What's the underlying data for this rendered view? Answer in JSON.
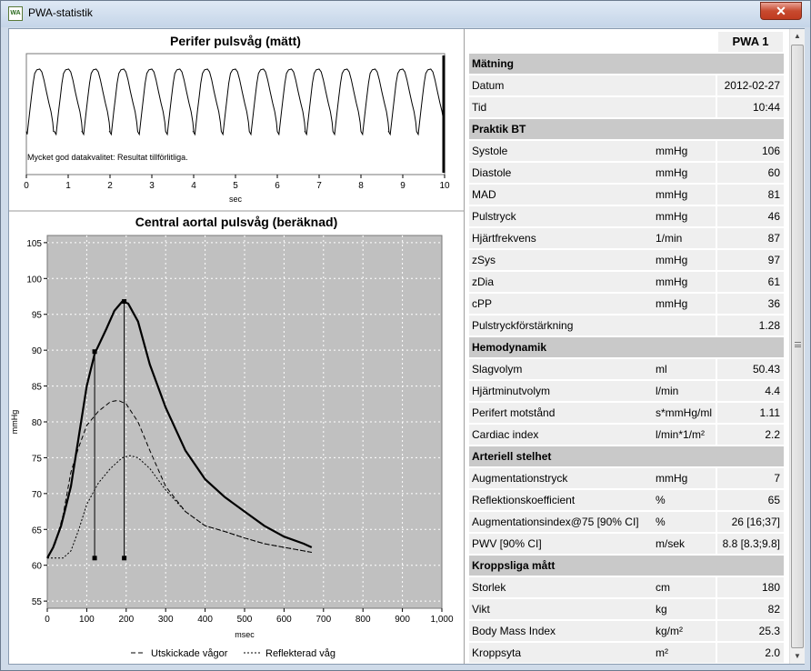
{
  "window": {
    "title": "PWA-statistik",
    "icon": "WA",
    "close_label": "✕"
  },
  "colors": {
    "table_section_bg": "#c9c9c9",
    "table_data_bg": "#efefef",
    "plot_bg": "#c0c0c0"
  },
  "chart_data": [
    {
      "type": "line",
      "title": "Perifer pulsvåg (mätt)",
      "xlabel": "sec",
      "ylabel": "",
      "xlim": [
        0,
        10
      ],
      "x_ticks": [
        "0",
        "1",
        "2",
        "3",
        "4",
        "5",
        "6",
        "7",
        "8",
        "9",
        "10"
      ],
      "annotation": "Mycket god datakvalitet: Resultat tillförlitliga.",
      "series": [
        {
          "beat_times": [
            0.32,
            1.01,
            1.67,
            2.33,
            3.0,
            3.67,
            4.33,
            5.0,
            5.67,
            6.34,
            7.0,
            7.67,
            8.34,
            9.0,
            9.67
          ]
        }
      ]
    },
    {
      "type": "line",
      "title": "Central aortal pulsvåg (beräknad)",
      "xlabel": "msec",
      "ylabel": "mmHg",
      "xlim": [
        0,
        1000
      ],
      "ylim": [
        54,
        106
      ],
      "grid": true,
      "x_ticks": [
        "0",
        "100",
        "200",
        "300",
        "400",
        "500",
        "600",
        "700",
        "800",
        "900",
        "1,000"
      ],
      "y_ticks": [
        "55",
        "60",
        "65",
        "70",
        "75",
        "80",
        "85",
        "90",
        "95",
        "100",
        "105"
      ],
      "legend_position": "bottom",
      "legend": [
        "Utskickade vågor",
        "Reflekterad våg"
      ],
      "series": [
        {
          "style": "solid",
          "x": [
            0,
            15,
            35,
            60,
            80,
            100,
            120,
            150,
            170,
            190,
            205,
            230,
            260,
            300,
            350,
            400,
            450,
            500,
            550,
            600,
            650,
            670
          ],
          "y": [
            61,
            62.5,
            65.5,
            71,
            78,
            85,
            89.5,
            93,
            95.5,
            96.8,
            96.5,
            94,
            88,
            82,
            76,
            72,
            69.5,
            67.5,
            65.5,
            64,
            63,
            62.5
          ]
        },
        {
          "name": "Utskickade vågor",
          "style": "dashed",
          "x": [
            0,
            20,
            40,
            60,
            80,
            100,
            130,
            160,
            180,
            200,
            230,
            260,
            300,
            350,
            400,
            450,
            500,
            550,
            600,
            650,
            670
          ],
          "y": [
            61,
            63,
            67,
            73,
            76.5,
            79.5,
            81.5,
            82.8,
            83,
            82.5,
            80,
            76,
            71,
            67.5,
            65.5,
            64.7,
            63.8,
            63,
            62.5,
            62,
            61.8
          ]
        },
        {
          "name": "Reflekterad våg",
          "style": "dotted",
          "x": [
            0,
            40,
            60,
            80,
            100,
            130,
            160,
            190,
            210,
            230,
            260,
            300,
            350,
            400,
            450,
            500,
            550,
            600,
            650,
            670
          ],
          "y": [
            61,
            61,
            62,
            65,
            68.5,
            71.5,
            73.5,
            75,
            75.3,
            75,
            73.5,
            70.5,
            67.5,
            65.5,
            64.7,
            63.8,
            63,
            62.5,
            62,
            61.8
          ]
        }
      ],
      "markers": [
        {
          "x": 120,
          "y_low": 61,
          "y_high": 89.8
        },
        {
          "x": 195,
          "y_low": 61,
          "y_high": 96.8
        }
      ]
    }
  ],
  "table": {
    "column_header": "PWA 1",
    "rows": [
      {
        "type": "section",
        "label": "Mätning"
      },
      {
        "type": "data",
        "label": "Datum",
        "unit": "",
        "value": "2012-02-27"
      },
      {
        "type": "data",
        "label": "Tid",
        "unit": "",
        "value": "10:44"
      },
      {
        "type": "section",
        "label": "Praktik BT"
      },
      {
        "type": "data",
        "label": "Systole",
        "unit": "mmHg",
        "value": "106"
      },
      {
        "type": "data",
        "label": "Diastole",
        "unit": "mmHg",
        "value": "60"
      },
      {
        "type": "data",
        "label": "MAD",
        "unit": "mmHg",
        "value": "81"
      },
      {
        "type": "data",
        "label": "Pulstryck",
        "unit": "mmHg",
        "value": "46"
      },
      {
        "type": "data",
        "label": "Hjärtfrekvens",
        "unit": "1/min",
        "value": "87"
      },
      {
        "type": "data",
        "label": "zSys",
        "unit": "mmHg",
        "value": "97"
      },
      {
        "type": "data",
        "label": "zDia",
        "unit": "mmHg",
        "value": "61"
      },
      {
        "type": "data",
        "label": "cPP",
        "unit": "mmHg",
        "value": "36"
      },
      {
        "type": "data",
        "label": "Pulstryckförstärkning",
        "unit": "",
        "value": "1.28"
      },
      {
        "type": "section",
        "label": "Hemodynamik"
      },
      {
        "type": "data",
        "label": "Slagvolym",
        "unit": "ml",
        "value": "50.43"
      },
      {
        "type": "data",
        "label": "Hjärtminutvolym",
        "unit": "l/min",
        "value": "4.4"
      },
      {
        "type": "data",
        "label": "Perifert motstånd",
        "unit": "s*mmHg/ml",
        "value": "1.11"
      },
      {
        "type": "data",
        "label": "Cardiac index",
        "unit": "l/min*1/m²",
        "value": "2.2"
      },
      {
        "type": "section",
        "label": "Arteriell stelhet"
      },
      {
        "type": "data",
        "label": "Augmentationstryck",
        "unit": "mmHg",
        "value": "7"
      },
      {
        "type": "data",
        "label": "Reflektionskoefficient",
        "unit": "%",
        "value": "65"
      },
      {
        "type": "data",
        "label": "Augmentationsindex@75 [90% CI]",
        "unit": "%",
        "value": "26 [16;37]"
      },
      {
        "type": "data",
        "label": "PWV [90% CI]",
        "unit": "m/sek",
        "value": "8.8 [8.3;9.8]"
      },
      {
        "type": "section",
        "label": "Kroppsliga mått"
      },
      {
        "type": "data",
        "label": "Storlek",
        "unit": "cm",
        "value": "180"
      },
      {
        "type": "data",
        "label": "Vikt",
        "unit": "kg",
        "value": "82"
      },
      {
        "type": "data",
        "label": "Body Mass Index",
        "unit": "kg/m²",
        "value": "25.3"
      },
      {
        "type": "data",
        "label": "Kroppsyta",
        "unit": "m²",
        "value": "2.0"
      }
    ]
  },
  "scrollbar": {
    "up_icon": "▲",
    "down_icon": "▼"
  }
}
